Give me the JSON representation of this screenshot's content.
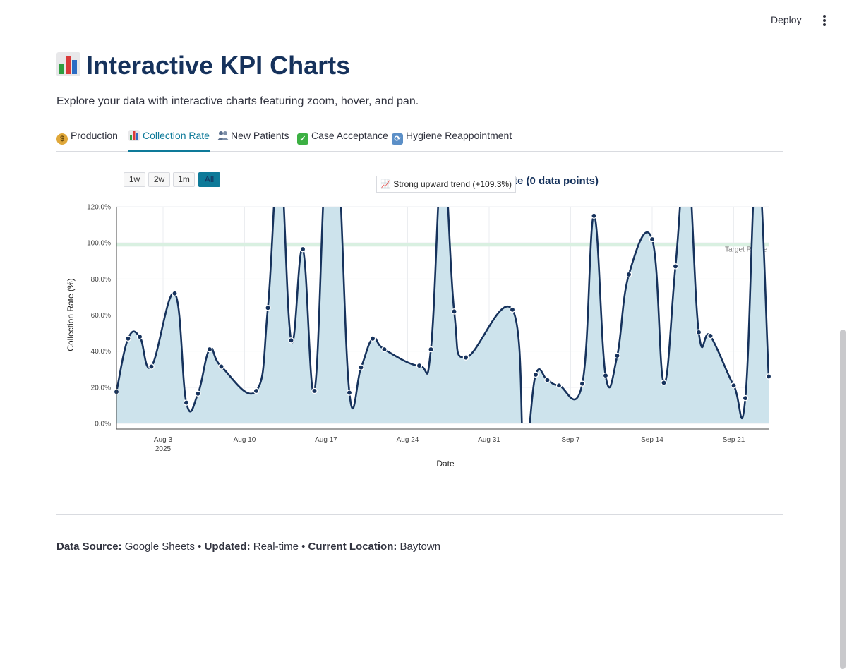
{
  "header": {
    "deploy_label": "Deploy"
  },
  "page": {
    "title": "Interactive KPI Charts",
    "subtitle": "Explore your data with interactive charts featuring zoom, hover, and pan."
  },
  "tabs": [
    {
      "label": "Production",
      "icon": "money-bag-icon",
      "active": false
    },
    {
      "label": "Collection Rate",
      "icon": "bar-chart-icon",
      "active": true
    },
    {
      "label": "New Patients",
      "icon": "people-icon",
      "active": false
    },
    {
      "label": "Case Acceptance",
      "icon": "check-mark-icon",
      "active": false
    },
    {
      "label": "Hygiene Reappointment",
      "icon": "refresh-icon",
      "active": false
    }
  ],
  "range_buttons": [
    {
      "label": "1w",
      "active": false
    },
    {
      "label": "2w",
      "active": false
    },
    {
      "label": "1m",
      "active": false
    },
    {
      "label": "All",
      "active": true
    }
  ],
  "chart_data": {
    "type": "area",
    "title": "te (0 data points)",
    "annotation": "📈 Strong upward trend (+109.3%)",
    "xlabel": "Date",
    "ylabel": "Collection Rate (%)",
    "x_ticks": [
      "Aug 3\n2025",
      "Aug 10",
      "Aug 17",
      "Aug 24",
      "Aug 31",
      "Sep 7",
      "Sep 14",
      "Sep 21"
    ],
    "y_ticks": [
      "0.0%",
      "20.0%",
      "40.0%",
      "60.0%",
      "80.0%",
      "100.0%",
      "120.0%"
    ],
    "ylim": [
      0,
      120
    ],
    "target_label": "Target Range",
    "target_range": [
      98,
      100
    ],
    "line_color": "#16325c",
    "fill_color": "#cde3ec",
    "target_color": "#d9f0e1",
    "grid": true,
    "points": [
      [
        "2025-07-30",
        17.5
      ],
      [
        "2025-07-31",
        47.0
      ],
      [
        "2025-08-01",
        48.0
      ],
      [
        "2025-08-02",
        31.5
      ],
      [
        "2025-08-04",
        72.0
      ],
      [
        "2025-08-05",
        11.5
      ],
      [
        "2025-08-06",
        16.5
      ],
      [
        "2025-08-07",
        41.0
      ],
      [
        "2025-08-08",
        31.5
      ],
      [
        "2025-08-11",
        18.0
      ],
      [
        "2025-08-12",
        64.0
      ],
      [
        "2025-08-13",
        150.0
      ],
      [
        "2025-08-14",
        46.0
      ],
      [
        "2025-08-15",
        96.5
      ],
      [
        "2025-08-16",
        18.0
      ],
      [
        "2025-08-17",
        150.0
      ],
      [
        "2025-08-18",
        150.0
      ],
      [
        "2025-08-19",
        17.0
      ],
      [
        "2025-08-20",
        31.0
      ],
      [
        "2025-08-21",
        47.0
      ],
      [
        "2025-08-22",
        41.0
      ],
      [
        "2025-08-25",
        32.0
      ],
      [
        "2025-08-26",
        41.0
      ],
      [
        "2025-08-27",
        150.0
      ],
      [
        "2025-08-28",
        62.0
      ],
      [
        "2025-08-29",
        36.5
      ],
      [
        "2025-09-02",
        63.0
      ],
      [
        "2025-09-03",
        -15.0
      ],
      [
        "2025-09-04",
        27.0
      ],
      [
        "2025-09-05",
        24.0
      ],
      [
        "2025-09-06",
        21.0
      ],
      [
        "2025-09-08",
        22.0
      ],
      [
        "2025-09-09",
        115.0
      ],
      [
        "2025-09-10",
        26.5
      ],
      [
        "2025-09-11",
        37.5
      ],
      [
        "2025-09-12",
        82.5
      ],
      [
        "2025-09-14",
        102.0
      ],
      [
        "2025-09-15",
        22.5
      ],
      [
        "2025-09-16",
        87.0
      ],
      [
        "2025-09-17",
        150.0
      ],
      [
        "2025-09-18",
        50.5
      ],
      [
        "2025-09-19",
        48.5
      ],
      [
        "2025-09-21",
        21.0
      ],
      [
        "2025-09-22",
        14.0
      ],
      [
        "2025-09-23",
        150.0
      ],
      [
        "2025-09-24",
        26.0
      ]
    ]
  },
  "footer": {
    "source_label": "Data Source:",
    "source_value": "Google Sheets",
    "sep1": "•",
    "updated_label": "Updated:",
    "updated_value": "Real-time",
    "sep2": "•",
    "location_label": "Current Location:",
    "location_value": "Baytown"
  }
}
